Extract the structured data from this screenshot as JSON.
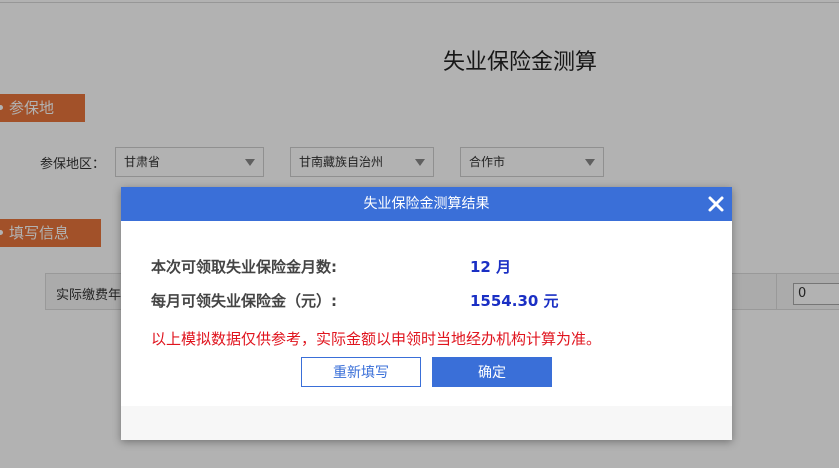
{
  "page": {
    "title": "失业保险金测算"
  },
  "sections": {
    "insured_place": "参保地",
    "fill_info": "填写信息"
  },
  "region": {
    "label": "参保地区：",
    "province": "甘肃省",
    "prefecture": "甘南藏族自治州",
    "city": "合作市"
  },
  "info": {
    "label": "实际缴费年",
    "input_value": "0"
  },
  "dialog": {
    "title": "失业保险金测算结果",
    "months_label": "本次可领取失业保险金月数:",
    "months_value": "12 月",
    "monthly_label": "每月可领失业保险金（元）:",
    "monthly_value": "1554.30 元",
    "disclaimer": "以上模拟数据仅供参考，实际金额以申领时当地经办机构计算为准。",
    "refill_label": "重新填写",
    "confirm_label": "确定"
  },
  "colors": {
    "accent": "#3a6fd8",
    "tag": "#e8753b",
    "value": "#1a2fc4",
    "warning": "#e0141e"
  }
}
